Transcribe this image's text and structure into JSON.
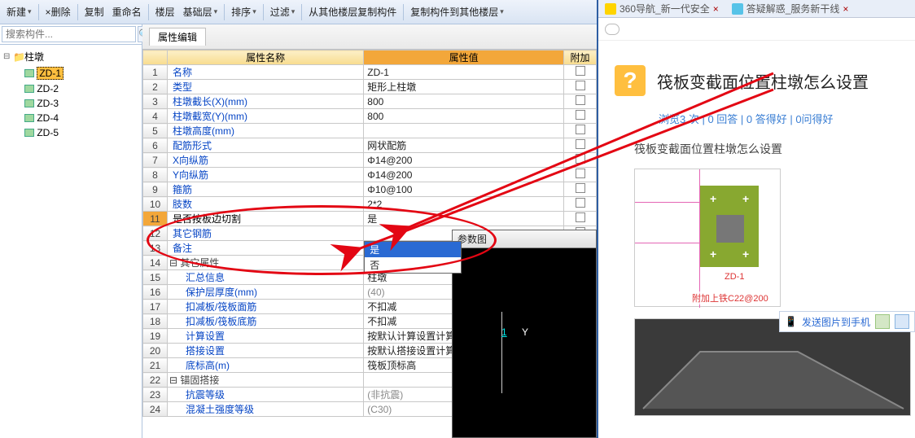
{
  "toolbar": {
    "new": "新建",
    "delete": "删除",
    "copy": "复制",
    "rename": "重命名",
    "floor": "楼层",
    "base_floor": "基础层",
    "sort": "排序",
    "filter": "过滤",
    "copy_from_other": "从其他楼层复制构件",
    "copy_to_other": "复制构件到其他楼层"
  },
  "search": {
    "placeholder": "搜索构件..."
  },
  "tree": {
    "root": "柱墩",
    "items": [
      "ZD-1",
      "ZD-2",
      "ZD-3",
      "ZD-4",
      "ZD-5"
    ]
  },
  "prop_tab": "属性编辑",
  "headers": {
    "name": "属性名称",
    "value": "属性值",
    "extra": "附加"
  },
  "rows": [
    {
      "n": 1,
      "name": "名称",
      "val": "ZD-1",
      "chk": false
    },
    {
      "n": 2,
      "name": "类型",
      "val": "矩形上柱墩",
      "chk": true
    },
    {
      "n": 3,
      "name": "柱墩截长(X)(mm)",
      "val": "800",
      "chk": true
    },
    {
      "n": 4,
      "name": "柱墩截宽(Y)(mm)",
      "val": "800",
      "chk": true
    },
    {
      "n": 5,
      "name": "柱墩高度(mm)",
      "val": "",
      "chk": true
    },
    {
      "n": 6,
      "name": "配筋形式",
      "val": "网状配筋",
      "chk": true
    },
    {
      "n": 7,
      "name": "X向纵筋",
      "val": "Φ14@200",
      "chk": true
    },
    {
      "n": 8,
      "name": "Y向纵筋",
      "val": "Φ14@200",
      "chk": true
    },
    {
      "n": 9,
      "name": "箍筋",
      "val": "Φ10@100",
      "chk": true
    },
    {
      "n": 10,
      "name": "肢数",
      "val": "2*2",
      "chk": true
    },
    {
      "n": 11,
      "name": "是否按板边切割",
      "val": "是",
      "chk": true,
      "hl": true
    },
    {
      "n": 12,
      "name": "其它钢筋",
      "val": "",
      "chk": false,
      "dropdown": true
    },
    {
      "n": 13,
      "name": "备注",
      "val": "",
      "chk": true
    }
  ],
  "group1": {
    "n": 14,
    "name": "其它属性"
  },
  "subrows": [
    {
      "n": 15,
      "name": "汇总信息",
      "val": "柱墩",
      "chk": true
    },
    {
      "n": 16,
      "name": "保护层厚度(mm)",
      "val": "(40)",
      "chk": true
    },
    {
      "n": 17,
      "name": "扣减板/筏板面筋",
      "val": "不扣减",
      "chk": true
    },
    {
      "n": 18,
      "name": "扣减板/筏板底筋",
      "val": "不扣减",
      "chk": true
    },
    {
      "n": 19,
      "name": "计算设置",
      "val": "按默认计算设置计算",
      "chk": false
    },
    {
      "n": 20,
      "name": "搭接设置",
      "val": "按默认搭接设置计算",
      "chk": false
    },
    {
      "n": 21,
      "name": "底标高(m)",
      "val": "筏板顶标高",
      "chk": true
    }
  ],
  "group2": {
    "n": 22,
    "name": "锚固搭接"
  },
  "subrows2": [
    {
      "n": 23,
      "name": "抗震等级",
      "val": "(非抗震)",
      "chk": true
    },
    {
      "n": 24,
      "name": "混凝土强度等级",
      "val": "(C30)",
      "chk": true
    }
  ],
  "dropdown_options": {
    "a": "是",
    "b": "否"
  },
  "param_title": "参数图",
  "param_y": "Y",
  "param_one": "1",
  "right": {
    "tabs": {
      "a": "360导航_新一代安全",
      "b": "答疑解惑_服务新干线"
    },
    "q_title": "筏板变截面位置柱墩怎么设置",
    "stats": "浏览3 次 | 0 回答 | 0 答得好 | 0问得好",
    "desc": "筏板变截面位置柱墩怎么设置",
    "send": "发送图片到手机",
    "thumb_lbl1": "ZD-1",
    "thumb_lbl2": "附加上铁C22@200"
  }
}
